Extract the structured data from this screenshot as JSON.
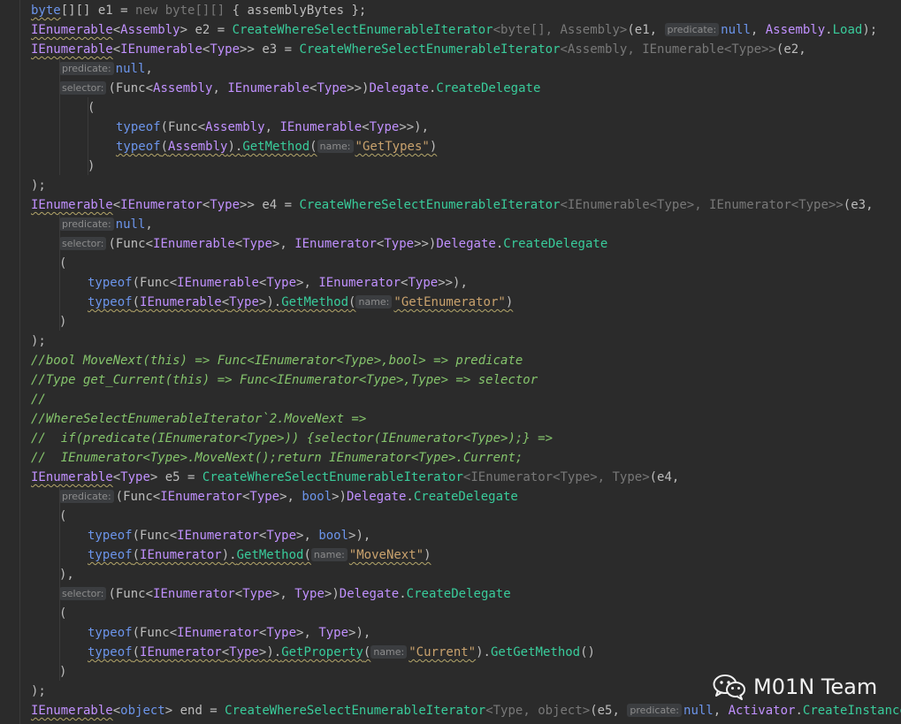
{
  "editor": {
    "lines": [
      {
        "indent": 0,
        "tokens": [
          [
            "byte",
            "kwb wavy"
          ],
          [
            "[][] e1 = ",
            "plain"
          ],
          [
            "new",
            "dim"
          ],
          [
            " byte[][] ",
            "dim"
          ],
          [
            "{ ",
            "plain"
          ],
          [
            "assemblyBytes",
            "local"
          ],
          [
            " };",
            "plain"
          ]
        ]
      },
      {
        "indent": 0,
        "tokens": [
          [
            "IEnumerable",
            "iface wavy"
          ],
          [
            "<",
            "plain"
          ],
          [
            "Assembly",
            "cls"
          ],
          [
            "> e2 = ",
            "plain"
          ],
          [
            "CreateWhereSelectEnumerableIterator",
            "meth"
          ],
          [
            "<byte[], Assembly>",
            "dim"
          ],
          [
            "(e1, ",
            "plain"
          ],
          [
            "predicate:",
            "hint"
          ],
          [
            "null",
            "kwb"
          ],
          [
            ", ",
            "plain"
          ],
          [
            "Assembly",
            "cls"
          ],
          [
            ".",
            "plain"
          ],
          [
            "Load",
            "meth"
          ],
          [
            ");",
            "plain"
          ]
        ]
      },
      {
        "indent": 0,
        "tokens": [
          [
            "IEnumerable",
            "iface wavy"
          ],
          [
            "<",
            "plain"
          ],
          [
            "IEnumerable",
            "iface"
          ],
          [
            "<",
            "plain"
          ],
          [
            "Type",
            "cls"
          ],
          [
            ">> e3 = ",
            "plain"
          ],
          [
            "CreateWhereSelectEnumerableIterator",
            "meth"
          ],
          [
            "<Assembly, IEnumerable<Type>>",
            "dim"
          ],
          [
            "(e2,",
            "plain"
          ]
        ]
      },
      {
        "indent": 1,
        "tokens": [
          [
            "predicate:",
            "hint"
          ],
          [
            "null",
            "kwb"
          ],
          [
            ",",
            "plain"
          ]
        ]
      },
      {
        "indent": 1,
        "tokens": [
          [
            "selector:",
            "hint"
          ],
          [
            "(Func<",
            "plain"
          ],
          [
            "Assembly",
            "cls"
          ],
          [
            ", ",
            "plain"
          ],
          [
            "IEnumerable",
            "iface"
          ],
          [
            "<",
            "plain"
          ],
          [
            "Type",
            "cls"
          ],
          [
            ">>)",
            "plain"
          ],
          [
            "Delegate",
            "cls"
          ],
          [
            ".",
            "plain"
          ],
          [
            "CreateDelegate",
            "meth"
          ]
        ]
      },
      {
        "indent": 2,
        "tokens": [
          [
            "(",
            "plain"
          ]
        ]
      },
      {
        "indent": 3,
        "tokens": [
          [
            "typeof",
            "kwb"
          ],
          [
            "(Func<",
            "plain"
          ],
          [
            "Assembly",
            "cls"
          ],
          [
            ", ",
            "plain"
          ],
          [
            "IEnumerable",
            "iface"
          ],
          [
            "<",
            "plain"
          ],
          [
            "Type",
            "cls"
          ],
          [
            ">>),",
            "plain"
          ]
        ]
      },
      {
        "indent": 3,
        "tokens": [
          [
            "typeof",
            "kwb wavy"
          ],
          [
            "(",
            "plain wavy"
          ],
          [
            "Assembly",
            "cls wavy"
          ],
          [
            ").",
            "plain wavy"
          ],
          [
            "GetMethod",
            "meth wavy"
          ],
          [
            "(",
            "plain wavy"
          ],
          [
            "name:",
            "hint"
          ],
          [
            "\"GetTypes\"",
            "str wavy"
          ],
          [
            ")",
            "plain wavy"
          ]
        ]
      },
      {
        "indent": 2,
        "tokens": [
          [
            ")",
            "plain"
          ]
        ]
      },
      {
        "indent": 0,
        "tokens": [
          [
            ");",
            "plain"
          ]
        ]
      },
      {
        "indent": 0,
        "tokens": [
          [
            "IEnumerable",
            "iface wavy"
          ],
          [
            "<",
            "plain"
          ],
          [
            "IEnumerator",
            "iface"
          ],
          [
            "<",
            "plain"
          ],
          [
            "Type",
            "cls"
          ],
          [
            ">> e4 = ",
            "plain"
          ],
          [
            "CreateWhereSelectEnumerableIterator",
            "meth"
          ],
          [
            "<IEnumerable<Type>, IEnumerator<Type>>",
            "dim"
          ],
          [
            "(e3,",
            "plain"
          ]
        ]
      },
      {
        "indent": 1,
        "tokens": [
          [
            "predicate:",
            "hint"
          ],
          [
            "null",
            "kwb"
          ],
          [
            ",",
            "plain"
          ]
        ]
      },
      {
        "indent": 1,
        "tokens": [
          [
            "selector:",
            "hint"
          ],
          [
            "(Func<",
            "plain"
          ],
          [
            "IEnumerable",
            "iface"
          ],
          [
            "<",
            "plain"
          ],
          [
            "Type",
            "cls"
          ],
          [
            ">, ",
            "plain"
          ],
          [
            "IEnumerator",
            "iface"
          ],
          [
            "<",
            "plain"
          ],
          [
            "Type",
            "cls"
          ],
          [
            ">>)",
            "plain"
          ],
          [
            "Delegate",
            "cls"
          ],
          [
            ".",
            "plain"
          ],
          [
            "CreateDelegate",
            "meth"
          ]
        ]
      },
      {
        "indent": 1,
        "tokens": [
          [
            "(",
            "plain"
          ]
        ]
      },
      {
        "indent": 2,
        "tokens": [
          [
            "typeof",
            "kwb"
          ],
          [
            "(Func<",
            "plain"
          ],
          [
            "IEnumerable",
            "iface"
          ],
          [
            "<",
            "plain"
          ],
          [
            "Type",
            "cls"
          ],
          [
            ">, ",
            "plain"
          ],
          [
            "IEnumerator",
            "iface"
          ],
          [
            "<",
            "plain"
          ],
          [
            "Type",
            "cls"
          ],
          [
            ">>),",
            "plain"
          ]
        ]
      },
      {
        "indent": 2,
        "tokens": [
          [
            "typeof",
            "kwb wavy"
          ],
          [
            "(",
            "plain wavy"
          ],
          [
            "IEnumerable",
            "iface wavy"
          ],
          [
            "<",
            "plain wavy"
          ],
          [
            "Type",
            "cls wavy"
          ],
          [
            ">).",
            "plain wavy"
          ],
          [
            "GetMethod",
            "meth wavy"
          ],
          [
            "(",
            "plain wavy"
          ],
          [
            "name:",
            "hint"
          ],
          [
            "\"GetEnumerator\"",
            "str wavy"
          ],
          [
            ")",
            "plain wavy"
          ]
        ]
      },
      {
        "indent": 1,
        "tokens": [
          [
            ")",
            "plain"
          ]
        ]
      },
      {
        "indent": 0,
        "tokens": [
          [
            ");",
            "plain"
          ]
        ]
      },
      {
        "indent": 0,
        "tokens": [
          [
            "//bool MoveNext(this) => Func<IEnumerator<Type>,bool> => predicate",
            "cmt"
          ]
        ]
      },
      {
        "indent": 0,
        "tokens": [
          [
            "//Type get_Current(this) => Func<IEnumerator<Type>,Type> => selector",
            "cmt"
          ]
        ]
      },
      {
        "indent": 0,
        "tokens": [
          [
            "//",
            "cmt"
          ]
        ]
      },
      {
        "indent": 0,
        "tokens": [
          [
            "//WhereSelectEnumerableIterator`2.MoveNext =>",
            "cmt"
          ]
        ]
      },
      {
        "indent": 0,
        "tokens": [
          [
            "//  if(predicate(IEnumerator<Type>)) {selector(IEnumerator<Type>);} =>",
            "cmt"
          ]
        ]
      },
      {
        "indent": 0,
        "tokens": [
          [
            "//  IEnumerator<Type>.MoveNext();return IEnumerator<Type>.Current;",
            "cmt"
          ]
        ]
      },
      {
        "indent": 0,
        "tokens": [
          [
            "IEnumerable",
            "iface wavy"
          ],
          [
            "<",
            "plain"
          ],
          [
            "Type",
            "cls"
          ],
          [
            "> e5 = ",
            "plain"
          ],
          [
            "CreateWhereSelectEnumerableIterator",
            "meth"
          ],
          [
            "<IEnumerator<Type>, Type>",
            "dim"
          ],
          [
            "(e4,",
            "plain"
          ]
        ]
      },
      {
        "indent": 1,
        "tokens": [
          [
            "predicate:",
            "hint"
          ],
          [
            "(Func<",
            "plain"
          ],
          [
            "IEnumerator",
            "iface"
          ],
          [
            "<",
            "plain"
          ],
          [
            "Type",
            "cls"
          ],
          [
            ">, ",
            "plain"
          ],
          [
            "bool",
            "kwb"
          ],
          [
            ">)",
            "plain"
          ],
          [
            "Delegate",
            "cls"
          ],
          [
            ".",
            "plain"
          ],
          [
            "CreateDelegate",
            "meth"
          ]
        ]
      },
      {
        "indent": 1,
        "tokens": [
          [
            "(",
            "plain"
          ]
        ]
      },
      {
        "indent": 2,
        "tokens": [
          [
            "typeof",
            "kwb"
          ],
          [
            "(Func<",
            "plain"
          ],
          [
            "IEnumerator",
            "iface"
          ],
          [
            "<",
            "plain"
          ],
          [
            "Type",
            "cls"
          ],
          [
            ">, ",
            "plain"
          ],
          [
            "bool",
            "kwb"
          ],
          [
            ">),",
            "plain"
          ]
        ]
      },
      {
        "indent": 2,
        "tokens": [
          [
            "typeof",
            "kwb wavy"
          ],
          [
            "(",
            "plain wavy"
          ],
          [
            "IEnumerator",
            "iface wavy"
          ],
          [
            ").",
            "plain wavy"
          ],
          [
            "GetMethod",
            "meth wavy"
          ],
          [
            "(",
            "plain wavy"
          ],
          [
            "name:",
            "hint"
          ],
          [
            "\"MoveNext\"",
            "str wavy"
          ],
          [
            ")",
            "plain wavy"
          ]
        ]
      },
      {
        "indent": 1,
        "tokens": [
          [
            "),",
            "plain"
          ]
        ]
      },
      {
        "indent": 1,
        "tokens": [
          [
            "selector:",
            "hint"
          ],
          [
            "(Func<",
            "plain"
          ],
          [
            "IEnumerator",
            "iface"
          ],
          [
            "<",
            "plain"
          ],
          [
            "Type",
            "cls"
          ],
          [
            ">, ",
            "plain"
          ],
          [
            "Type",
            "cls"
          ],
          [
            ">)",
            "plain"
          ],
          [
            "Delegate",
            "cls"
          ],
          [
            ".",
            "plain"
          ],
          [
            "CreateDelegate",
            "meth"
          ]
        ]
      },
      {
        "indent": 1,
        "tokens": [
          [
            "(",
            "plain"
          ]
        ]
      },
      {
        "indent": 2,
        "tokens": [
          [
            "typeof",
            "kwb"
          ],
          [
            "(Func<",
            "plain"
          ],
          [
            "IEnumerator",
            "iface"
          ],
          [
            "<",
            "plain"
          ],
          [
            "Type",
            "cls"
          ],
          [
            ">, ",
            "plain"
          ],
          [
            "Type",
            "cls"
          ],
          [
            ">),",
            "plain"
          ]
        ]
      },
      {
        "indent": 2,
        "tokens": [
          [
            "typeof",
            "kwb wavy"
          ],
          [
            "(",
            "plain wavy"
          ],
          [
            "IEnumerator",
            "iface wavy"
          ],
          [
            "<",
            "plain wavy"
          ],
          [
            "Type",
            "cls wavy"
          ],
          [
            ">).",
            "plain wavy"
          ],
          [
            "GetProperty",
            "meth wavy"
          ],
          [
            "(",
            "plain wavy"
          ],
          [
            "name:",
            "hint"
          ],
          [
            "\"Current\"",
            "str wavy"
          ],
          [
            ").",
            "plain"
          ],
          [
            "GetGetMethod",
            "meth"
          ],
          [
            "()",
            "plain"
          ]
        ]
      },
      {
        "indent": 1,
        "tokens": [
          [
            ")",
            "plain"
          ]
        ]
      },
      {
        "indent": 0,
        "tokens": [
          [
            ");",
            "plain"
          ]
        ]
      },
      {
        "indent": 0,
        "tokens": [
          [
            "IEnumerable",
            "iface wavy"
          ],
          [
            "<",
            "plain"
          ],
          [
            "object",
            "kwb"
          ],
          [
            "> end = ",
            "plain"
          ],
          [
            "CreateWhereSelectEnumerableIterator",
            "meth"
          ],
          [
            "<Type, object>",
            "dim"
          ],
          [
            "(e5, ",
            "plain"
          ],
          [
            "predicate:",
            "hint"
          ],
          [
            "null",
            "kwb"
          ],
          [
            ", ",
            "plain"
          ],
          [
            "Activator",
            "cls"
          ],
          [
            ".",
            "plain"
          ],
          [
            "CreateInstance",
            "meth"
          ],
          [
            ");",
            "plain"
          ]
        ]
      }
    ]
  },
  "watermark": {
    "text": "M01N Team",
    "icon": "wechat-icon"
  },
  "colors": {
    "background": "#2b2b2b",
    "keyword": "#6c95eb",
    "type": "#c191ff",
    "method": "#39cc9b",
    "string": "#c9a26d",
    "comment": "#85c46c"
  }
}
